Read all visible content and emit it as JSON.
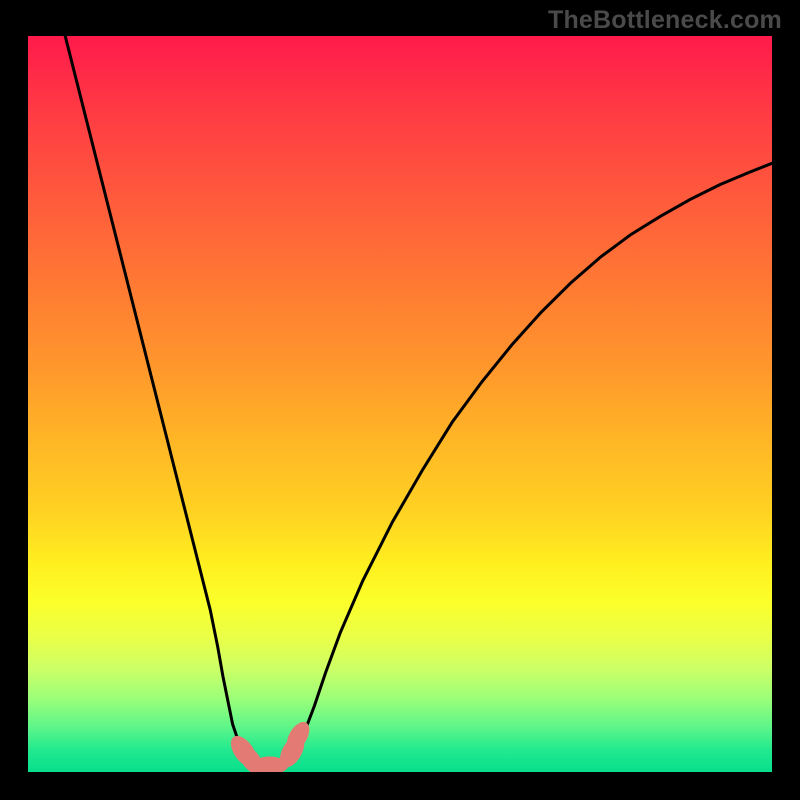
{
  "watermark": "TheBottleneck.com",
  "colors": {
    "gradient_top": "#ff1a4b",
    "gradient_bottom": "#07df8c",
    "curve": "#000000",
    "marker": "#e47a74",
    "frame": "#000000"
  },
  "chart_data": {
    "type": "line",
    "title": "",
    "xlabel": "",
    "ylabel": "",
    "x_range": [
      0,
      100
    ],
    "y_range": [
      0,
      100
    ],
    "background": "rainbow-vertical-gradient",
    "series": [
      {
        "name": "left-arm",
        "x": [
          5,
          6.5,
          8,
          9.5,
          11,
          12.5,
          14,
          15.5,
          17,
          18.5,
          20,
          21.5,
          23,
          24.5,
          25.5,
          26.2,
          26.8,
          27.2,
          27.5,
          28,
          28.5,
          29,
          29.3
        ],
        "y": [
          100,
          94,
          88,
          82,
          76,
          70,
          64,
          58,
          52,
          46,
          40,
          34,
          28,
          22,
          17,
          13,
          10,
          8,
          6.5,
          5,
          3.5,
          2.2,
          1.2
        ]
      },
      {
        "name": "floor",
        "x": [
          29.3,
          30,
          31,
          32,
          33,
          34,
          35,
          35.5
        ],
        "y": [
          1.2,
          0.9,
          0.8,
          0.8,
          0.9,
          1.1,
          1.6,
          2.0
        ]
      },
      {
        "name": "right-arm",
        "x": [
          35.5,
          36.2,
          37,
          38.5,
          40,
          42,
          45,
          49,
          53,
          57,
          61,
          65,
          69,
          73,
          77,
          81,
          85,
          89,
          93,
          97,
          100
        ],
        "y": [
          2.0,
          3.2,
          5,
          9,
          13.5,
          19,
          26,
          34,
          41,
          47.5,
          53,
          58,
          62.5,
          66.5,
          70,
          73,
          75.5,
          77.8,
          79.8,
          81.5,
          82.7
        ]
      }
    ],
    "markers": [
      {
        "name": "cluster-left",
        "x": 29.0,
        "y": 2.8,
        "rx": 1.3,
        "ry": 2.4,
        "rot": -35
      },
      {
        "name": "cluster-left2",
        "x": 30.0,
        "y": 1.6,
        "rx": 1.2,
        "ry": 2.1,
        "rot": -35
      },
      {
        "name": "floor-mid",
        "x": 32.5,
        "y": 0.9,
        "rx": 2.5,
        "ry": 1.2,
        "rot": 0
      },
      {
        "name": "cluster-right",
        "x": 35.5,
        "y": 2.8,
        "rx": 1.3,
        "ry": 2.4,
        "rot": 30
      },
      {
        "name": "cluster-right2",
        "x": 36.3,
        "y": 4.8,
        "rx": 1.2,
        "ry": 2.2,
        "rot": 30
      }
    ]
  }
}
